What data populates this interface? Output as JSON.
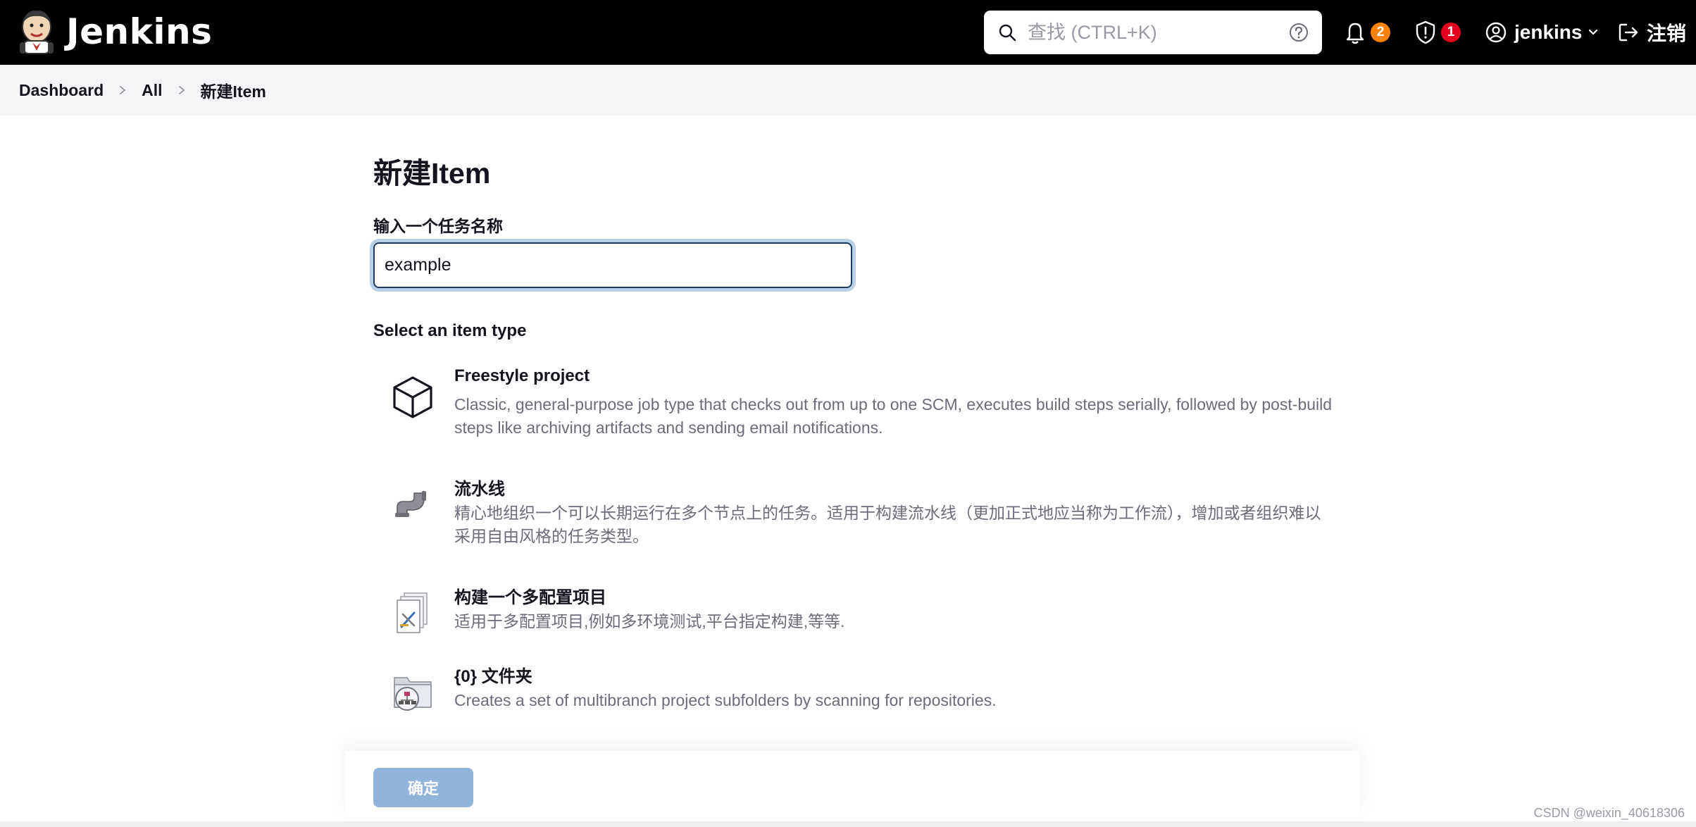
{
  "header": {
    "brand": "Jenkins",
    "search": {
      "placeholder": "查找 (CTRL+K)"
    },
    "notifications": {
      "count": "2",
      "color": "#fe820a"
    },
    "security": {
      "count": "1",
      "color": "#e6001f"
    },
    "user": {
      "name": "jenkins"
    },
    "logout_label": "注销"
  },
  "breadcrumb": {
    "items": [
      "Dashboard",
      "All",
      "新建Item"
    ]
  },
  "main": {
    "title": "新建Item",
    "name_label": "输入一个任务名称",
    "name_value": "example",
    "type_heading": "Select an item type",
    "types": [
      {
        "name": "Freestyle project",
        "description": "Classic, general-purpose job type that checks out from up to one SCM, executes build steps serially, followed by post-build steps like archiving artifacts and sending email notifications.",
        "icon": "package-icon"
      },
      {
        "name": "流水线",
        "description": "精心地组织一个可以长期运行在多个节点上的任务。适用于构建流水线（更加正式地应当称为工作流），增加或者组织难以采用自由风格的任务类型。",
        "icon": "pipe-icon"
      },
      {
        "name": "构建一个多配置项目",
        "description": "适用于多配置项目,例如多环境测试,平台指定构建,等等.",
        "icon": "multi-config-icon"
      },
      {
        "name": "{0} 文件夹",
        "description": "Creates a set of multibranch project subfolders by scanning for repositories.",
        "icon": "folder-icon"
      }
    ]
  },
  "footer": {
    "ok_label": "确定",
    "ok_color": "#93b4da"
  },
  "watermark": "CSDN @weixin_40618306"
}
